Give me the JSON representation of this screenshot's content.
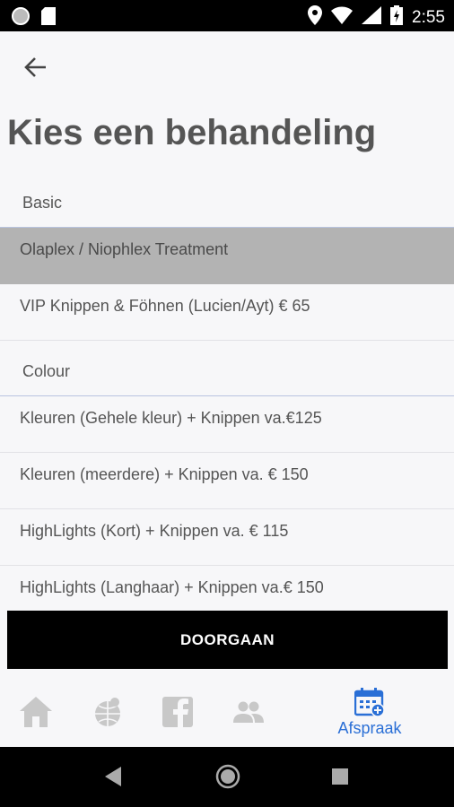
{
  "status_bar": {
    "time": "2:55"
  },
  "page": {
    "title": "Kies een behandeling"
  },
  "sections": [
    {
      "title": "Basic",
      "items": [
        {
          "label": "Olaplex / Niophlex Treatment",
          "selected": true
        },
        {
          "label": "VIP Knippen & Föhnen (Lucien/Ayt) € 65",
          "selected": false
        }
      ]
    },
    {
      "title": "Colour",
      "items": [
        {
          "label": "Kleuren (Gehele kleur) + Knippen va.€125",
          "selected": false
        },
        {
          "label": "Kleuren (meerdere) + Knippen va. € 150",
          "selected": false
        },
        {
          "label": "HighLights (Kort) + Knippen va. € 115",
          "selected": false
        },
        {
          "label": "HighLights (Langhaar) + Knippen va.€ 150",
          "selected": false
        }
      ]
    }
  ],
  "actions": {
    "continue_label": "DOORGAAN"
  },
  "tabs": [
    {
      "icon": "home-icon",
      "active": false
    },
    {
      "icon": "globe-icon",
      "active": false
    },
    {
      "icon": "facebook-icon",
      "active": false
    },
    {
      "icon": "people-icon",
      "active": false
    },
    {
      "icon": "calendar-add-icon",
      "label": "Afspraak",
      "active": true
    }
  ],
  "colors": {
    "accent": "#2a6fd6",
    "selected_row": "#b3b3b3",
    "inactive_icon": "#c8c8c8"
  }
}
